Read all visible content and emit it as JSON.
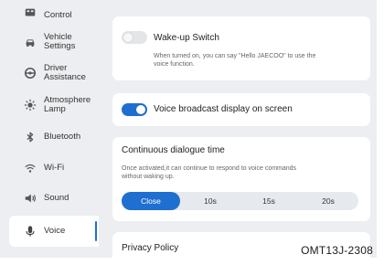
{
  "sidebar": {
    "items": [
      {
        "label": "Control",
        "icon": "control-icon"
      },
      {
        "label": "Vehicle\nSettings",
        "icon": "car-icon"
      },
      {
        "label": "Driver\nAssistance",
        "icon": "steering-wheel-icon"
      },
      {
        "label": "Atmosphere\nLamp",
        "icon": "lamp-icon"
      },
      {
        "label": "Bluetooth",
        "icon": "bluetooth-icon"
      },
      {
        "label": "Wi-Fi",
        "icon": "wifi-icon"
      },
      {
        "label": "Sound",
        "icon": "speaker-icon"
      },
      {
        "label": "Voice",
        "icon": "microphone-icon",
        "active": true
      }
    ]
  },
  "wakeup": {
    "title": "Wake-up Switch",
    "description": "When turned on, you can say \"Hello JAECOO\" to use the\nvoice function.",
    "enabled": false
  },
  "broadcast": {
    "title": "Voice broadcast display on screen",
    "enabled": true
  },
  "dialogue": {
    "title": "Continuous dialogue time",
    "description": "Once activated,it can continue to respond to voice commands\nwithout waking up.",
    "options": [
      "Close",
      "10s",
      "15s",
      "20s"
    ],
    "selected": "Close"
  },
  "privacy": {
    "title": "Privacy Policy"
  },
  "figure_code": "OMT13J-2308",
  "colors": {
    "accent": "#1f6fd1",
    "background": "#eceef1",
    "card": "#ffffff"
  }
}
